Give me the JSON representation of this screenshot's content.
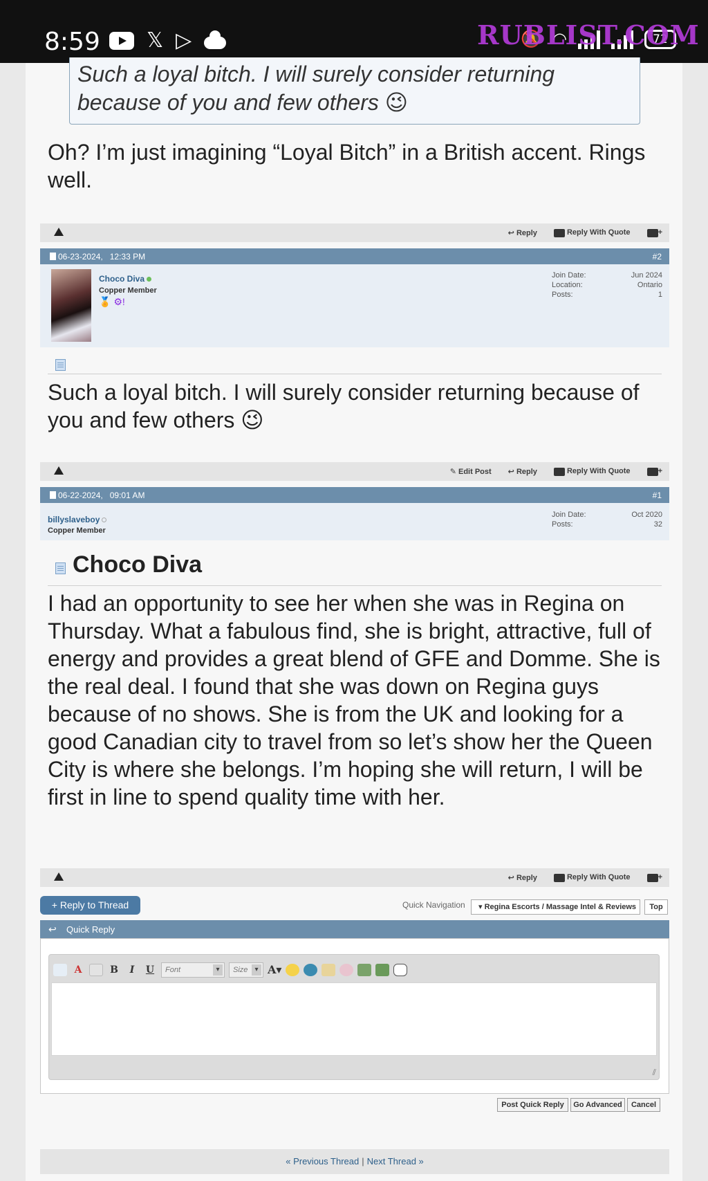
{
  "status_bar": {
    "time": "8:59",
    "battery": "72",
    "watermark": "RUBLIST.COM"
  },
  "quote": {
    "text": "Such a loyal bitch. I will surely consider returning because of you and few others 😉"
  },
  "reply_post": {
    "body": "Oh? I’m just imagining “Loyal Bitch” in a British accent. Rings well."
  },
  "actions": {
    "reply": "Reply",
    "reply_with_quote": "Reply With Quote",
    "edit_post": "Edit Post"
  },
  "post2": {
    "date": "06-23-2024,",
    "time": "12:33 PM",
    "number": "#2",
    "username": "Choco Diva",
    "usertitle": "Copper Member",
    "join_date_label": "Join Date:",
    "join_date": "Jun 2024",
    "location_label": "Location:",
    "location": "Ontario",
    "posts_label": "Posts:",
    "posts": "1",
    "body": "Such a loyal bitch. I will surely consider returning because of you and few others 😉"
  },
  "post1": {
    "date": "06-22-2024,",
    "time": "09:01 AM",
    "number": "#1",
    "username": "billyslaveboy",
    "usertitle": "Copper Member",
    "join_date_label": "Join Date:",
    "join_date": "Oct 2020",
    "posts_label": "Posts:",
    "posts": "32",
    "title": "Choco Diva",
    "body": "I had an opportunity to see her when she was in Regina on Thursday. What a fabulous find, she is bright, attractive, full of energy and provides a great blend of GFE and Domme. She is the real deal. I found that she was down on Regina guys because of no shows. She is from the UK and looking for a good Canadian city to travel from so let’s show her the Queen City is where she belongs. I’m hoping she will return, I will be first in line to spend quality time with her."
  },
  "thread_controls": {
    "reply_to_thread": "+ Reply to Thread",
    "quick_navigation": "Quick Navigation",
    "forum_select": "▾ Regina Escorts / Massage Intel & Reviews",
    "top": "Top"
  },
  "quick_reply": {
    "title": "Quick Reply",
    "font_placeholder": "Font",
    "size_placeholder": "Size",
    "post_quick_reply": "Post Quick Reply",
    "go_advanced": "Go Advanced",
    "cancel": "Cancel"
  },
  "thread_nav": {
    "previous": "« Previous Thread",
    "separator": "|",
    "next": "Next Thread »"
  }
}
